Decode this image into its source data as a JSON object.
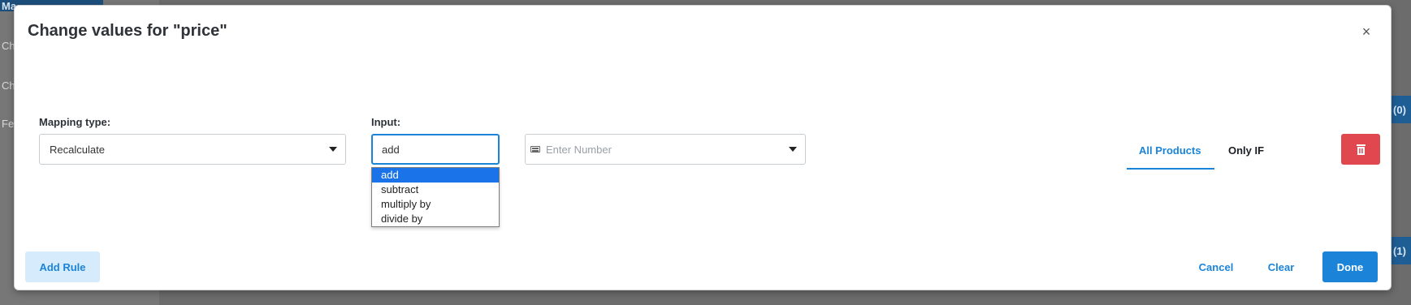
{
  "modal": {
    "title": "Change values for \"price\"",
    "close_label": "×"
  },
  "mapping": {
    "label": "Mapping type:",
    "value": "Recalculate"
  },
  "input": {
    "label": "Input:",
    "value": "add",
    "options": [
      "add",
      "subtract",
      "multiply by",
      "divide by"
    ]
  },
  "number": {
    "placeholder": "Enter Number"
  },
  "tabs": {
    "all": "All Products",
    "only": "Only IF"
  },
  "footer": {
    "add_rule": "Add Rule",
    "cancel": "Cancel",
    "clear": "Clear",
    "done": "Done"
  },
  "background": {
    "sidebar": [
      "Ma",
      "Ch",
      "Ch",
      "Fe"
    ],
    "badges": [
      "(0)",
      "(1)"
    ]
  },
  "colors": {
    "accent": "#1b84d8",
    "danger": "#e1474f"
  }
}
